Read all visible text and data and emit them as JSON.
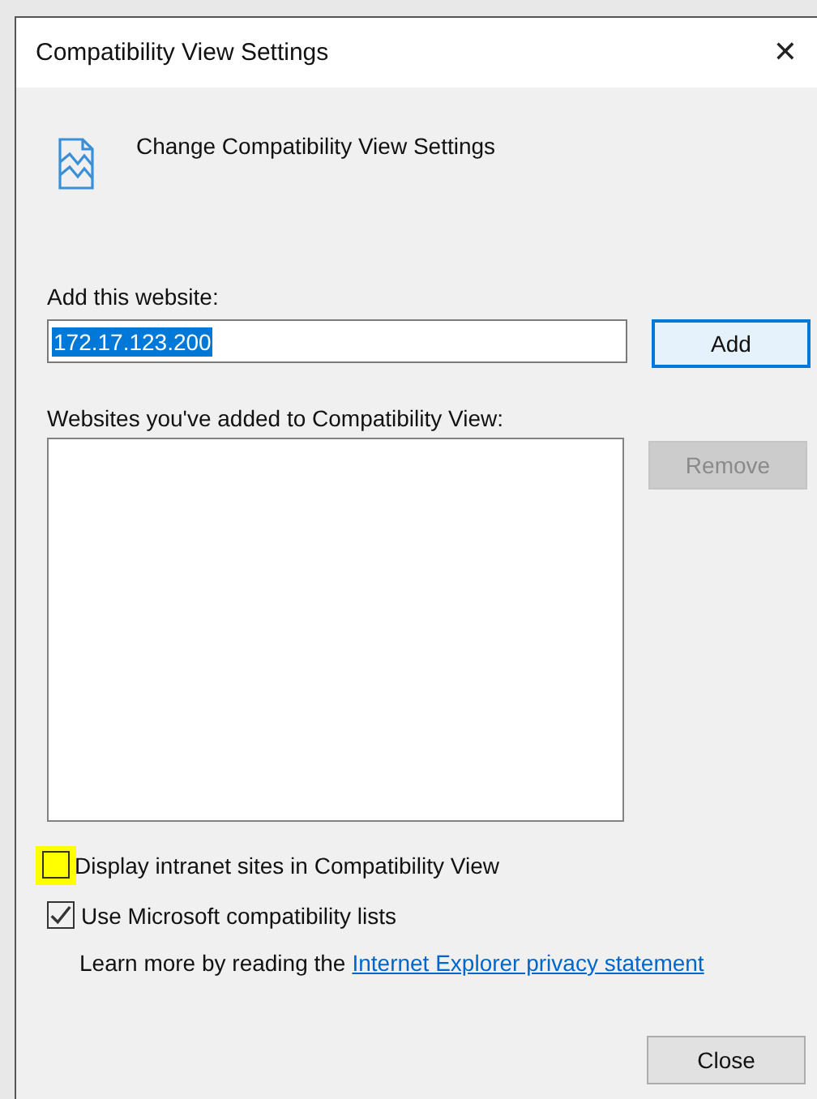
{
  "window": {
    "title": "Compatibility View Settings",
    "close": "✕"
  },
  "heading": "Change Compatibility View Settings",
  "add_field": {
    "label": "Add this website:",
    "value": "172.17.123.200",
    "selected": true
  },
  "add_button": {
    "label": "Add",
    "disabled": false
  },
  "list": {
    "label": "Websites you've added to Compatibility View:"
  },
  "remove_button": {
    "label": "Remove",
    "disabled": true
  },
  "options": [
    {
      "label": "Display intranet sites in Compatibility View",
      "checked": false,
      "highlighted": true
    },
    {
      "label": "Use Microsoft compatibility lists",
      "checked": true,
      "highlighted": false
    }
  ],
  "learn_more": {
    "text": "Learn more by reading the",
    "link": "Internet Explorer privacy statement"
  },
  "close_button": {
    "label": "Close"
  }
}
